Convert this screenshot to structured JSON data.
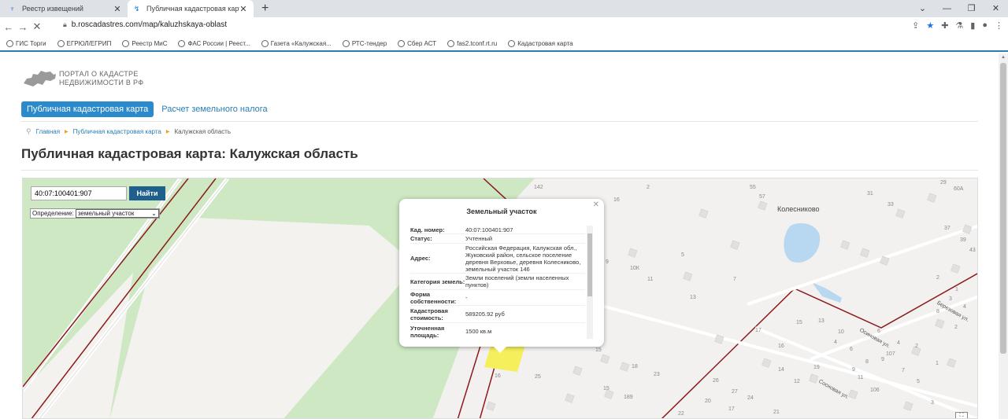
{
  "browser": {
    "tabs": [
      {
        "title": "Реестр извещений",
        "active": false
      },
      {
        "title": "Публичная кадастровая карта: К",
        "active": true
      }
    ],
    "url": "b.roscadastres.com/map/kaluzhskaya-oblast",
    "bookmarks": [
      "ГИС Торги",
      "ЕГРЮЛ/ЕГРИП",
      "Реестр МиС",
      "ФАС России | Реест...",
      "Газета «Калужская...",
      "РТС-тендер",
      "Сбер АСТ",
      "fas2.tconf.rt.ru",
      "Кадастровая карта"
    ]
  },
  "site": {
    "logo_line1": "ПОРТАЛ О КАДАСТРЕ",
    "logo_line2": "НЕДВИЖИМОСТИ В РФ",
    "menu_active": "Публичная кадастровая карта",
    "menu_link": "Расчет земельного налога",
    "breadcrumbs": [
      "Главная",
      "Публичная кадастровая карта",
      "Калужская область"
    ],
    "title": "Публичная кадастровая карта: Калужская область"
  },
  "map": {
    "search_value": "40:07:100401:907",
    "search_button": "Найти",
    "def_label": "Определение:",
    "def_value": "земельный участок",
    "place": "Колесниково",
    "streets": [
      "Березовая ул.",
      "Осиновая ул.",
      "Сосновая ул."
    ],
    "numbers": [
      "142",
      "2",
      "16",
      "55",
      "57",
      "29",
      "60А",
      "31",
      "33",
      "37",
      "39",
      "43",
      "5",
      "9",
      "10К",
      "11",
      "7",
      "13",
      "15",
      "16",
      "17",
      "19",
      "12",
      "13",
      "14",
      "15",
      "18",
      "23",
      "25",
      "26",
      "27",
      "24",
      "22",
      "20",
      "21",
      "17",
      "16",
      "15",
      "189",
      "106",
      "107",
      "9",
      "7",
      "5",
      "3",
      "1",
      "2",
      "4",
      "6",
      "8",
      "3",
      "4",
      "2",
      "1",
      "2",
      "4",
      "6",
      "8",
      "11",
      "10",
      "9"
    ]
  },
  "popup": {
    "title": "Земельный участок",
    "rows": [
      {
        "k": "Кад. номер:",
        "v": "40:07:100401:907"
      },
      {
        "k": "Статус:",
        "v": "Учтенный"
      },
      {
        "k": "Адрес:",
        "v": "Российская Федерация, Калужская обл., Жуковский район, сельское поселение деревня Верховье, деревня Колесниково, земельный участок 146"
      },
      {
        "k": "Категория земель:",
        "v": "Земли поселений (земли населенных пунктов)"
      },
      {
        "k": "Форма собственности:",
        "v": "-"
      },
      {
        "k": "Кадастровая стоимость:",
        "v": "589205.92 руб"
      },
      {
        "k": "Уточненная площадь:",
        "v": "1500 кв.м"
      }
    ]
  }
}
